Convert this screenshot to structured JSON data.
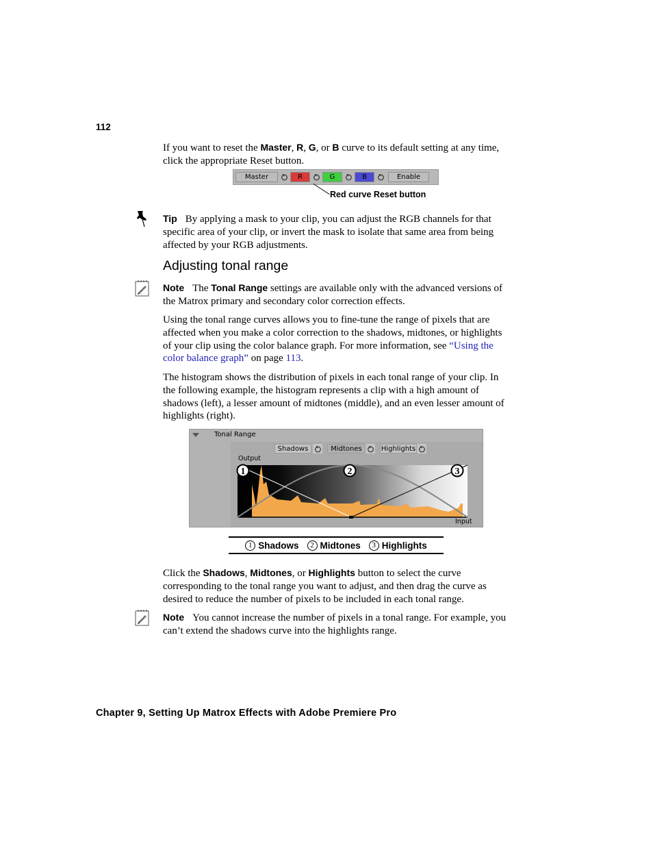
{
  "page_number": "112",
  "intro": {
    "parts": [
      {
        "t": "If you want to reset the ",
        "b": false
      },
      {
        "t": "Master",
        "b": true
      },
      {
        "t": ", ",
        "b": false
      },
      {
        "t": "R",
        "b": true
      },
      {
        "t": ", ",
        "b": false
      },
      {
        "t": "G",
        "b": true
      },
      {
        "t": ", or ",
        "b": false
      },
      {
        "t": "B",
        "b": true
      },
      {
        "t": " curve to its default setting at any time, click the appropriate Reset button.",
        "b": false
      }
    ]
  },
  "rgb_bar": {
    "buttons": [
      {
        "label": "Master",
        "color": "#bdbdbd"
      },
      {
        "label": "R",
        "color": "#d83a3a"
      },
      {
        "label": "G",
        "color": "#3fce3f"
      },
      {
        "label": "B",
        "color": "#4a4ad2"
      }
    ],
    "enable_label": "Enable",
    "callout": "Red curve Reset button"
  },
  "tip": {
    "label": "Tip",
    "text": "By applying a mask to your clip, you can adjust the RGB channels for that specific area of your clip, or invert the mask to isolate that same area from being affected by your RGB adjustments."
  },
  "section_heading": "Adjusting tonal range",
  "note1": {
    "label": "Note",
    "parts": [
      {
        "t": "The ",
        "b": false
      },
      {
        "t": "Tonal Range",
        "b": true
      },
      {
        "t": " settings are available only with the advanced versions of the Matrox primary and secondary color correction effects.",
        "b": false
      }
    ]
  },
  "para1": {
    "text": "Using the tonal range curves allows you to fine-tune the range of pixels that are affected when you make a color correction to the shadows, midtones, or highlights of your clip using the color balance graph. For more information, see ",
    "link_text": "“Using the color balance graph”",
    "mid": " on page ",
    "page_link": "113",
    "end": "."
  },
  "para2": {
    "text": "The histogram shows the distribution of pixels in each tonal range of your clip. In the following example, the histogram represents a clip with a high amount of shadows (left), a lesser amount of midtones (middle), and an even lesser amount of highlights (right)."
  },
  "tonal_panel": {
    "title": "Tonal Range",
    "buttons": [
      "Shadows",
      "Midtones",
      "Highlights"
    ],
    "output_label": "Output",
    "input_label": "Input",
    "markers": [
      "1",
      "2",
      "3"
    ],
    "histogram_color": "#f2a84a"
  },
  "legend": {
    "items": [
      {
        "num": "1",
        "label": "Shadows"
      },
      {
        "num": "2",
        "label": "Midtones"
      },
      {
        "num": "3",
        "label": "Highlights"
      }
    ]
  },
  "para3": {
    "parts": [
      {
        "t": "Click the ",
        "b": false
      },
      {
        "t": "Shadows",
        "b": true
      },
      {
        "t": ", ",
        "b": false
      },
      {
        "t": "Midtones",
        "b": true
      },
      {
        "t": ", or ",
        "b": false
      },
      {
        "t": "Highlights",
        "b": true
      },
      {
        "t": " button to select the curve corresponding to the tonal range you want to adjust, and then drag the curve as desired to reduce the number of pixels to be included in each tonal range.",
        "b": false
      }
    ]
  },
  "note2": {
    "label": "Note",
    "text": "You cannot increase the number of pixels in a tonal range. For example, you can’t extend the shadows curve into the highlights range."
  },
  "footer": "Chapter 9, Setting Up Matrox Effects with Adobe Premiere Pro"
}
